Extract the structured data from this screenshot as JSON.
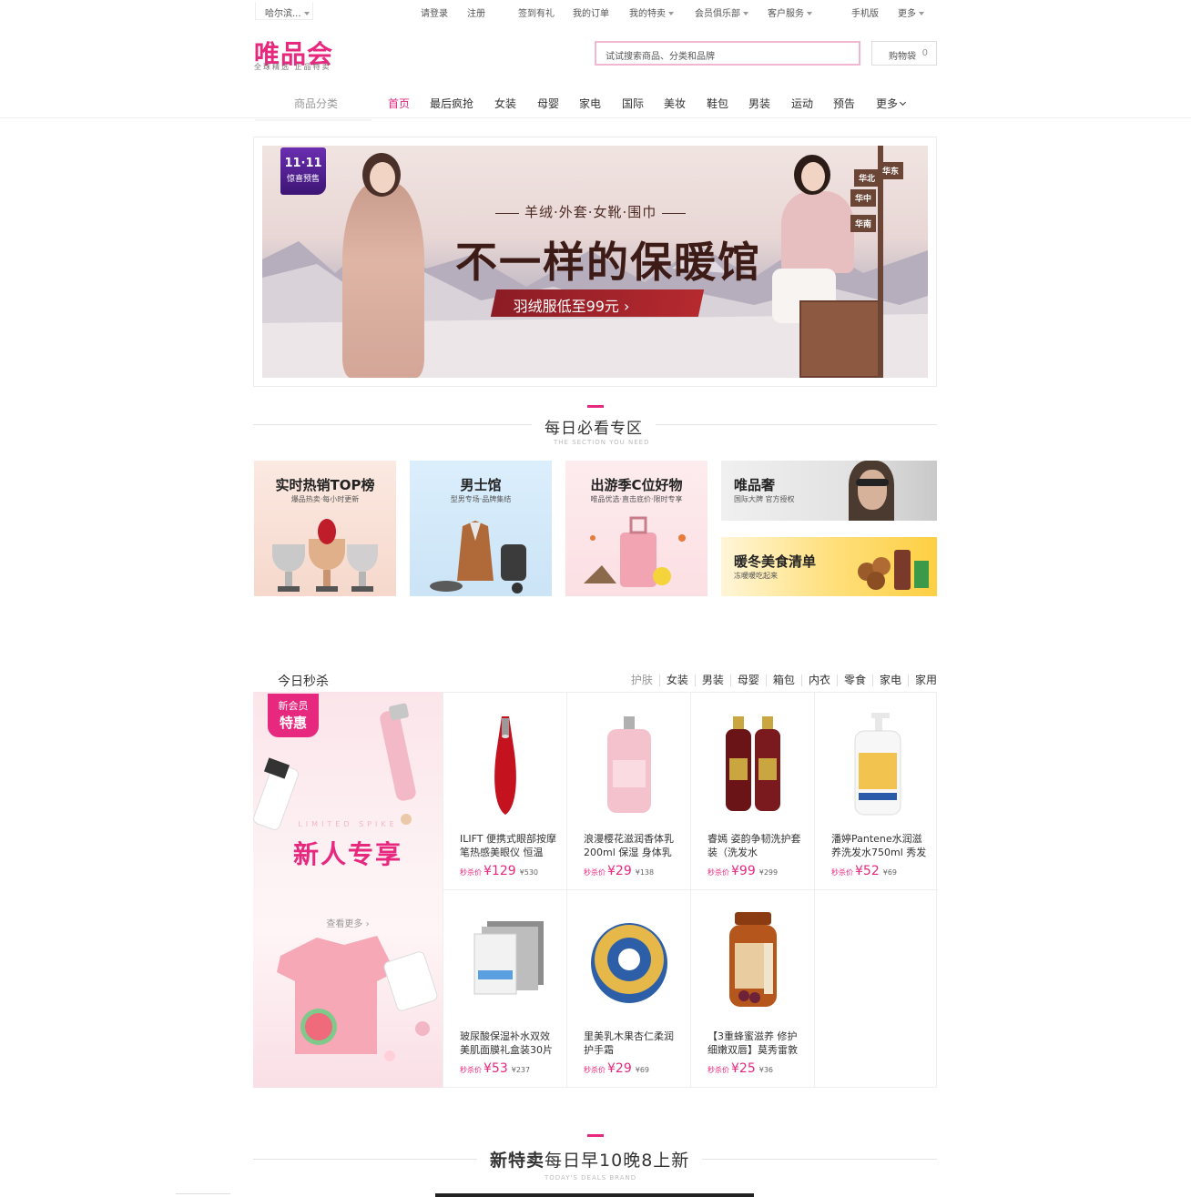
{
  "topbar": {
    "city": "哈尔滨...",
    "links": [
      {
        "label": "请登录",
        "caret": false
      },
      {
        "label": "注册",
        "caret": false
      },
      {
        "label": "签到有礼",
        "caret": false
      },
      {
        "label": "我的订单",
        "caret": false
      },
      {
        "label": "我的特卖",
        "caret": true
      },
      {
        "label": "会员俱乐部",
        "caret": true
      },
      {
        "label": "客户服务",
        "caret": true
      },
      {
        "label": "手机版",
        "caret": false
      },
      {
        "label": "更多",
        "caret": true
      }
    ]
  },
  "header": {
    "logo": "唯品会",
    "slogan": "全球精选 正品特卖",
    "search_placeholder": "试试搜索商品、分类和品牌",
    "cart_label": "购物袋",
    "cart_count": "0"
  },
  "nav": {
    "category_label": "商品分类",
    "items": [
      "首页",
      "最后疯抢",
      "女装",
      "母婴",
      "家电",
      "国际",
      "美妆",
      "鞋包",
      "男装",
      "运动",
      "预告",
      "更多"
    ],
    "active_index": 0
  },
  "banner": {
    "badge_line1": "11·11",
    "badge_line2": "惊喜预售",
    "subtitle": "羊绒·外套·女靴·围巾",
    "title": "不一样的保暖馆",
    "button": "羽绒服低至99元 ›",
    "signs": [
      "华北",
      "华东",
      "华中",
      "华南"
    ]
  },
  "daily": {
    "title": "每日必看专区",
    "subtitle_en": "THE SECTION YOU NEED",
    "tiles": [
      {
        "title": "实时热销TOP榜",
        "subtitle": "爆品热卖·每小时更新"
      },
      {
        "title": "男士馆",
        "subtitle": "型男专场·品牌集结"
      },
      {
        "title": "出游季C位好物",
        "subtitle": "唯品优选·直击底价·限时专享"
      },
      {
        "title": "唯品奢",
        "subtitle": "国际大牌 官方授权"
      },
      {
        "title": "暖冬美食清单",
        "subtitle": "冻暖暖吃起来"
      }
    ]
  },
  "flash_sale": {
    "title": "今日秒杀",
    "tabs": [
      "护肤",
      "女装",
      "男装",
      "母婴",
      "箱包",
      "内衣",
      "零食",
      "家电",
      "家用"
    ],
    "active_tab": 0,
    "promo": {
      "badge_line1": "新会员",
      "badge_line2": "特惠",
      "en": "LIMITED SPIKE",
      "title": "新人专享",
      "more": "查看更多 ›"
    },
    "price_label": "秒杀价",
    "products": [
      {
        "name": "ILIFT 便携式眼部按摩笔热感美眼仪 恒温",
        "price": "¥129",
        "old": "¥530",
        "icon": "red-massage-pen"
      },
      {
        "name": "浪漫樱花滋润香体乳200ml 保湿 身体乳",
        "price": "¥29",
        "old": "¥138",
        "icon": "pink-lotion-bottle"
      },
      {
        "name": "睿嫣 姿韵争韧洗护套装（洗发水",
        "price": "¥99",
        "old": "¥299",
        "icon": "shampoo-bottles"
      },
      {
        "name": "潘婷Pantene水润滋养洗发水750ml 秀发",
        "price": "¥52",
        "old": "¥69",
        "icon": "pump-bottle"
      },
      {
        "name": "玻尿酸保湿补水双效美肌面膜礼盒装30片",
        "price": "¥53",
        "old": "¥237",
        "icon": "mask-box"
      },
      {
        "name": "里美乳木果杏仁柔润护手霜",
        "price": "¥29",
        "old": "¥69",
        "icon": "cream-tin"
      },
      {
        "name": "【3重蜂蜜滋养 修护细嫩双唇】莫秀雷敦",
        "price": "¥25",
        "old": "¥36",
        "icon": "honey-jar"
      }
    ]
  },
  "new_sale": {
    "title_bold": "新特卖",
    "title_rest": "每日早10晚8上新",
    "subtitle_en": "TODAY'S DEALS BRAND"
  },
  "colors": {
    "brand": "#e6287e",
    "search_border": "#f1b6d0"
  }
}
